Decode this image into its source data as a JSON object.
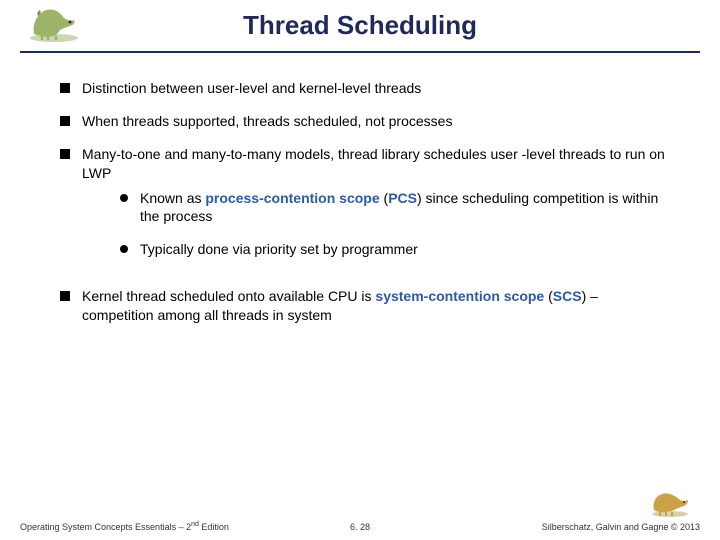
{
  "title": "Thread Scheduling",
  "bullets": {
    "b0": "Distinction between user-level and kernel-level threads",
    "b1": "When threads supported, threads scheduled, not processes",
    "b2": "Many-to-one and many-to-many models, thread library schedules user -level threads to run on LWP",
    "b2_sub": {
      "s0_pre": "Known as ",
      "s0_term1": "process-contention scope",
      "s0_mid": " (",
      "s0_term2": "PCS",
      "s0_post": ") since scheduling competition is within the process",
      "s1": "Typically done via priority set by programmer"
    },
    "b3_pre": "Kernel thread scheduled onto available CPU is ",
    "b3_term1": "system-contention scope",
    "b3_mid": " (",
    "b3_term2": "SCS",
    "b3_post": ") – competition among all threads in system"
  },
  "footer": {
    "left_pre": "Operating System Concepts Essentials – 2",
    "left_sup": "nd",
    "left_post": " Edition",
    "center": "6. 28",
    "right": "Silberschatz, Galvin and Gagne © 2013"
  }
}
